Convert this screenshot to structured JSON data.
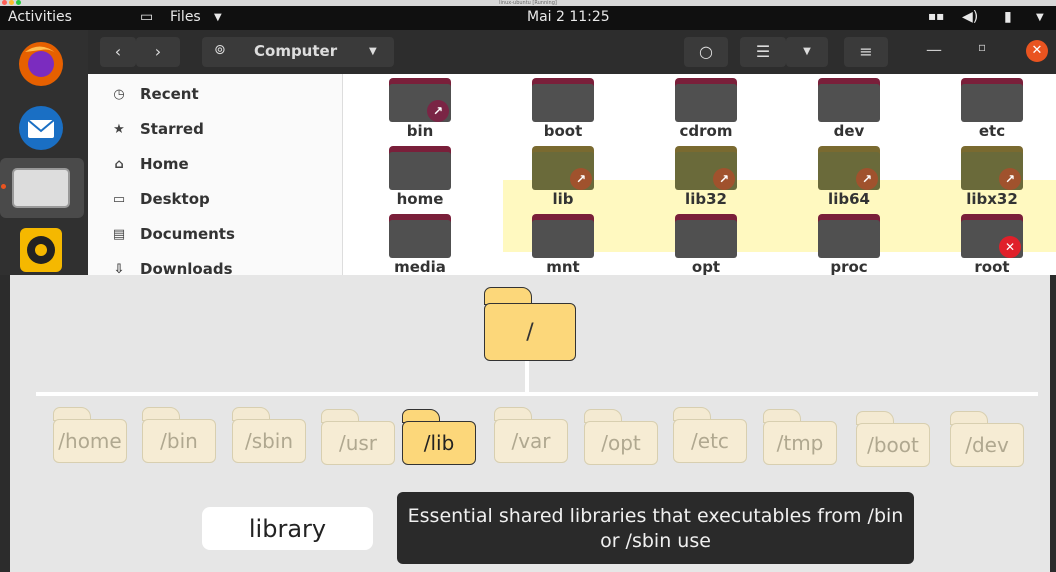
{
  "vm_title": "linux-ubuntu [Running]",
  "topbar": {
    "activities": "Activities",
    "app_menu": "Files",
    "clock": "Mai 2  11:25"
  },
  "header": {
    "location": "Computer"
  },
  "sidebar": {
    "items": [
      {
        "label": "Recent",
        "icon": "clock-icon"
      },
      {
        "label": "Starred",
        "icon": "star-icon"
      },
      {
        "label": "Home",
        "icon": "home-icon"
      },
      {
        "label": "Desktop",
        "icon": "desktop-icon"
      },
      {
        "label": "Documents",
        "icon": "documents-icon"
      },
      {
        "label": "Downloads",
        "icon": "download-icon"
      }
    ]
  },
  "files": [
    {
      "name": "bin",
      "badge": "link"
    },
    {
      "name": "boot"
    },
    {
      "name": "cdrom"
    },
    {
      "name": "dev"
    },
    {
      "name": "etc"
    },
    {
      "name": "home"
    },
    {
      "name": "lib",
      "badge": "link"
    },
    {
      "name": "lib32",
      "badge": "link"
    },
    {
      "name": "lib64",
      "badge": "link"
    },
    {
      "name": "libx32",
      "badge": "link"
    },
    {
      "name": "media"
    },
    {
      "name": "mnt"
    },
    {
      "name": "opt"
    },
    {
      "name": "proc"
    },
    {
      "name": "root",
      "badge": "locked"
    }
  ],
  "overlay": {
    "root_label": "/",
    "folders": [
      "/home",
      "/bin",
      "/sbin",
      "/usr",
      "/lib",
      "/var",
      "/opt",
      "/etc",
      "/tmp",
      "/boot",
      "/dev"
    ],
    "active": "/lib",
    "term": "library",
    "description": "Essential shared libraries that executables from /bin or /sbin use"
  },
  "colors": {
    "accent": "#e95420",
    "folder_yellow": "#fcd77a",
    "highlight": "#fff9c0"
  }
}
